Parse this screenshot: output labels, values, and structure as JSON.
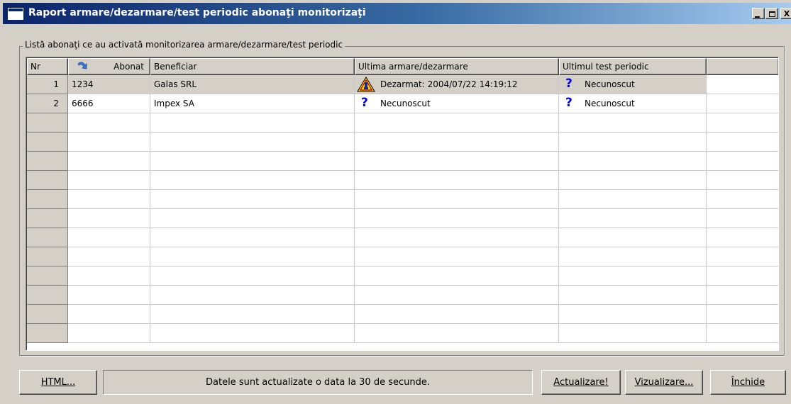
{
  "window": {
    "title": "Raport armare/dezarmare/test periodic abonaţi monitorizaţi",
    "controls": {
      "minimize": "_",
      "maximize": "□",
      "close": "X"
    }
  },
  "group": {
    "legend": "Listă abonaţi ce au activată monitorizarea armare/dezarmare/test periodic"
  },
  "grid": {
    "columns": [
      "Nr",
      "Abonat",
      "Beneficiar",
      "Ultima armare/dezarmare",
      "Ultimul test periodic",
      ""
    ],
    "rows": [
      {
        "nr": "1",
        "abonat": "1234",
        "beneficiar": "Galas SRL",
        "armare_icon": "warning-icon",
        "armare": "Dezarmat: 2004/07/22 14:19:12",
        "test_icon": "question-icon",
        "test": "Necunoscut"
      },
      {
        "nr": "2",
        "abonat": "6666",
        "beneficiar": "Impex SA",
        "armare_icon": "question-icon",
        "armare": "Necunoscut",
        "test_icon": "question-icon",
        "test": "Necunoscut"
      }
    ],
    "selected_row": 0
  },
  "footer": {
    "html_button": "HTML...",
    "status": "Datele sunt actualizate o data la 30 de secunde.",
    "actualizare_button": "Actualizare!",
    "vizualizare_button": "Vizualizare...",
    "inchide_button": "Închide"
  },
  "colors": {
    "face": "#d4d0c8",
    "title_start": "#0a246a",
    "title_end": "#a6caf0",
    "question": "#0000d8",
    "warning": "#ffd800"
  }
}
